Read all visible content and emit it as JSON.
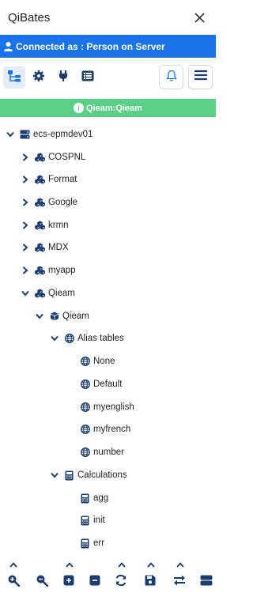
{
  "app": {
    "title": "QiBates",
    "close_icon": "close-icon"
  },
  "connection": {
    "text": "Connected as : Person on Server",
    "icon": "user-icon",
    "color": "#1a73e8"
  },
  "toolbar": {
    "buttons": [
      {
        "icon": "tree-view-icon",
        "active": true
      },
      {
        "icon": "gear-icon",
        "active": false
      },
      {
        "icon": "plug-icon",
        "active": false
      },
      {
        "icon": "list-icon",
        "active": false
      }
    ],
    "right": [
      {
        "icon": "bell-icon"
      },
      {
        "icon": "menu-icon"
      }
    ]
  },
  "database_bar": {
    "text": "Qieam:Qieam",
    "color": "#5ccf86"
  },
  "tree": {
    "nodes": [
      {
        "label": "ecs-epmdev01",
        "icon": "server-icon",
        "expanded": true
      },
      {
        "label": "COSPNL",
        "icon": "cubes-icon",
        "expanded": false
      },
      {
        "label": "Format",
        "icon": "cubes-icon",
        "expanded": false
      },
      {
        "label": "Google",
        "icon": "cubes-icon",
        "expanded": false
      },
      {
        "label": "krmn",
        "icon": "cubes-icon",
        "expanded": false
      },
      {
        "label": "MDX",
        "icon": "cubes-icon",
        "expanded": false
      },
      {
        "label": "myapp",
        "icon": "cubes-icon",
        "expanded": false
      },
      {
        "label": "Qieam",
        "icon": "cubes-icon",
        "expanded": true
      },
      {
        "label": "Qieam",
        "icon": "cube-icon",
        "expanded": true
      },
      {
        "label": "Alias tables",
        "icon": "globe-icon",
        "expanded": true
      },
      {
        "label": "None",
        "icon": "globe-icon"
      },
      {
        "label": "Default",
        "icon": "globe-icon"
      },
      {
        "label": "myenglish",
        "icon": "globe-icon"
      },
      {
        "label": "myfrench",
        "icon": "globe-icon"
      },
      {
        "label": "number",
        "icon": "globe-icon"
      },
      {
        "label": "Calculations",
        "icon": "calculator-icon",
        "expanded": true
      },
      {
        "label": "agg",
        "icon": "calculator-icon"
      },
      {
        "label": "init",
        "icon": "calculator-icon"
      },
      {
        "label": "err",
        "icon": "calculator-icon"
      }
    ]
  },
  "bottom_toolbar": {
    "chevrons": [
      "chevron-up-icon",
      "chevron-up-icon",
      "chevron-up-icon",
      "chevron-up-icon",
      "chevron-up-icon"
    ],
    "buttons": [
      {
        "icon": "zoom-in-icon"
      },
      {
        "icon": "zoom-out-icon"
      },
      {
        "icon": "expand-plus-icon"
      },
      {
        "icon": "collapse-minus-icon"
      },
      {
        "icon": "refresh-icon"
      },
      {
        "icon": "save-icon"
      },
      {
        "icon": "swap-icon"
      },
      {
        "icon": "toggle-icon"
      }
    ]
  }
}
